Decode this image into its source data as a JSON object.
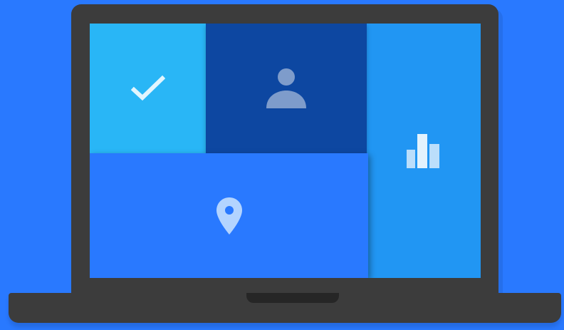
{
  "colors": {
    "background": "#2979FF",
    "bezel": "#3c3c3c",
    "tile_check": "#29B6F6",
    "tile_person": "#0D47A1",
    "tile_chart": "#2196F3",
    "tile_location": "#2979FF",
    "icon_check": "#E1F5FE",
    "icon_person": "#7E9CCB",
    "icon_chart": "#BBDEFB",
    "icon_location": "#B3D4FF"
  },
  "icons": {
    "check": "check-icon",
    "person": "person-icon",
    "chart": "bar-chart-icon",
    "location": "location-pin-icon"
  }
}
